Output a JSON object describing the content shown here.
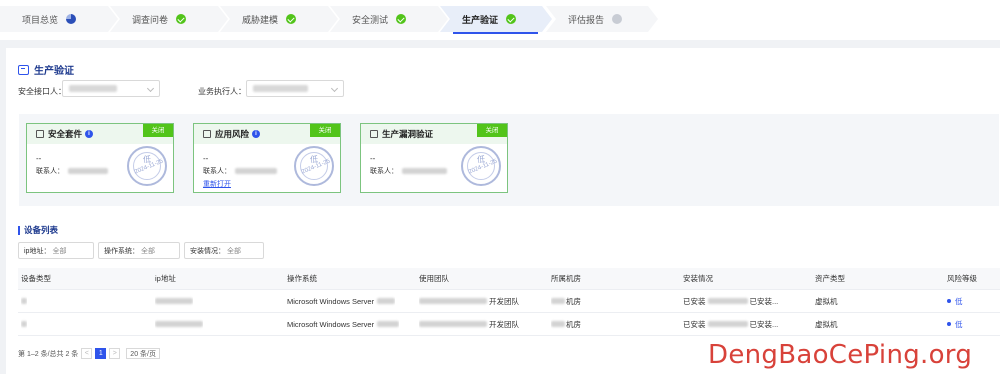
{
  "steps": [
    {
      "label": "项目总览",
      "status": "pie"
    },
    {
      "label": "调查问卷",
      "status": "done"
    },
    {
      "label": "威胁建模",
      "status": "done"
    },
    {
      "label": "安全测试",
      "status": "done"
    },
    {
      "label": "生产验证",
      "status": "done"
    },
    {
      "label": "评估报告",
      "status": "pending"
    }
  ],
  "section": {
    "title": "生产验证"
  },
  "filters_top": {
    "security_contact_label": "安全接口人：",
    "executor_label": "业务执行人："
  },
  "cards": [
    {
      "title": "安全套件",
      "tag": "关闭",
      "dash": "--",
      "contact_label": "联系人：",
      "reopen": "",
      "stamp_level": "低",
      "stamp_date": "2024-11-25"
    },
    {
      "title": "应用风险",
      "tag": "关闭",
      "dash": "--",
      "contact_label": "联系人：",
      "reopen": "重新打开",
      "stamp_level": "低",
      "stamp_date": "2024-11-25"
    },
    {
      "title": "生产漏洞验证",
      "tag": "关闭",
      "dash": "--",
      "contact_label": "联系人：",
      "reopen": "",
      "stamp_level": "低",
      "stamp_date": "2024-11-25"
    }
  ],
  "device_list": {
    "title": "设备列表",
    "filters": [
      {
        "label": "ip地址：",
        "value": "全部"
      },
      {
        "label": "操作系统：",
        "value": "全部"
      },
      {
        "label": "安装情况：",
        "value": "全部"
      }
    ],
    "columns": [
      "设备类型",
      "ip地址",
      "操作系统",
      "使用团队",
      "所属机房",
      "安装情况",
      "资产类型",
      "风险等级"
    ],
    "rows": [
      {
        "os": "Microsoft Windows Server",
        "team": "开发团队",
        "room": "机房",
        "install_a": "已安装",
        "install_b": "已安装...",
        "asset": "虚拟机",
        "risk": "低"
      },
      {
        "os": "Microsoft Windows Server",
        "team": "开发团队",
        "room": "机房",
        "install_a": "已安装",
        "install_b": "已安装...",
        "asset": "虚拟机",
        "risk": "低"
      }
    ]
  },
  "pagination": {
    "summary": "第 1–2 条/总共 2 条",
    "prev": "<",
    "current": "1",
    "next": ">",
    "page_size": "20 条/页"
  },
  "watermark": "DengBaoCePing.org",
  "colors": {
    "primary": "#2f54eb",
    "success": "#52c41a",
    "watermark": "#d8423a"
  }
}
